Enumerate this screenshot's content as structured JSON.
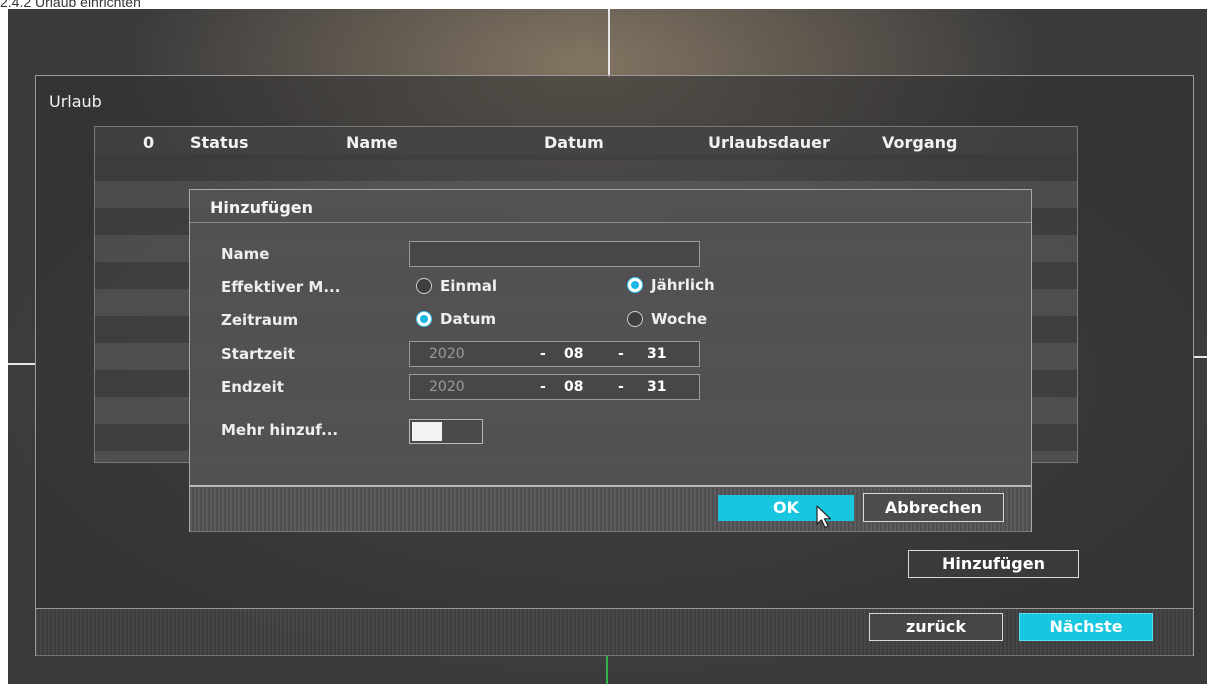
{
  "document": {
    "heading": "2.4.2 Urlaub einrichten"
  },
  "window": {
    "title": "Urlaub"
  },
  "table": {
    "columns": [
      "0",
      "Status",
      "Name",
      "Datum",
      "Urlaubsdauer",
      "Vorgang"
    ]
  },
  "dialog": {
    "title": "Hinzufügen",
    "name_label": "Name",
    "name_value": "",
    "effective_label": "Effektiver M...",
    "effective_options": [
      {
        "label": "Einmal",
        "selected": false
      },
      {
        "label": "Jährlich",
        "selected": true
      }
    ],
    "period_label": "Zeitraum",
    "period_options": [
      {
        "label": "Datum",
        "selected": true
      },
      {
        "label": "Woche",
        "selected": false
      }
    ],
    "start_label": "Startzeit",
    "start_date": {
      "year": "2020",
      "month": "08",
      "day": "31",
      "separator": "-"
    },
    "end_label": "Endzeit",
    "end_date": {
      "year": "2020",
      "month": "08",
      "day": "31",
      "separator": "-"
    },
    "more_label": "Mehr hinzuf...",
    "more_enabled": false,
    "ok_label": "OK",
    "cancel_label": "Abbrechen"
  },
  "add_button_label": "Hinzufügen",
  "footer": {
    "back_label": "zurück",
    "next_label": "Nächste"
  },
  "colors": {
    "accent": "#19c6e0",
    "radio_selected": "#19b7e4",
    "crosshair_green": "#2fb34a"
  },
  "icons": {
    "cursor": "mouse-pointer-icon"
  }
}
